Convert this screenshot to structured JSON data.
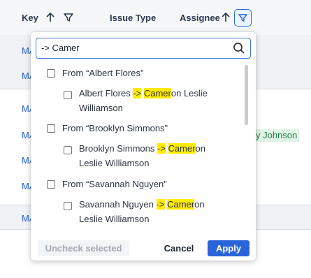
{
  "header": {
    "key_label": "Key",
    "issue_type_label": "Issue Type",
    "assignee_label": "Assignee"
  },
  "background_rows": {
    "key_fragments": [
      "MA",
      "MA",
      "MA",
      "MA",
      "MA",
      "MA",
      "MA"
    ],
    "assignee_fragment": "y Johnson"
  },
  "filter_popover": {
    "search": {
      "value": "-> Camer",
      "placeholder": ""
    },
    "groups": [
      {
        "label": "From “Albert Flores”",
        "item": {
          "parts": [
            "Albert Flores ",
            "->",
            " ",
            "Camer",
            "on Leslie Williamson"
          ]
        }
      },
      {
        "label": "From “Brooklyn Simmons”",
        "item": {
          "parts": [
            "Brooklyn Simmons ",
            "->",
            " ",
            "Camer",
            "on Leslie Williamson"
          ]
        }
      },
      {
        "label": "From “Savannah Nguyen”",
        "item": {
          "parts": [
            "Savannah Nguyen ",
            "->",
            " ",
            "Camer",
            "on Leslie Williamson"
          ]
        }
      }
    ],
    "buttons": {
      "uncheck": "Uncheck selected",
      "cancel": "Cancel",
      "apply": "Apply"
    }
  },
  "colors": {
    "accent": "#2b63d9",
    "highlight": "#ffeb00",
    "link": "#1f5fcc"
  }
}
